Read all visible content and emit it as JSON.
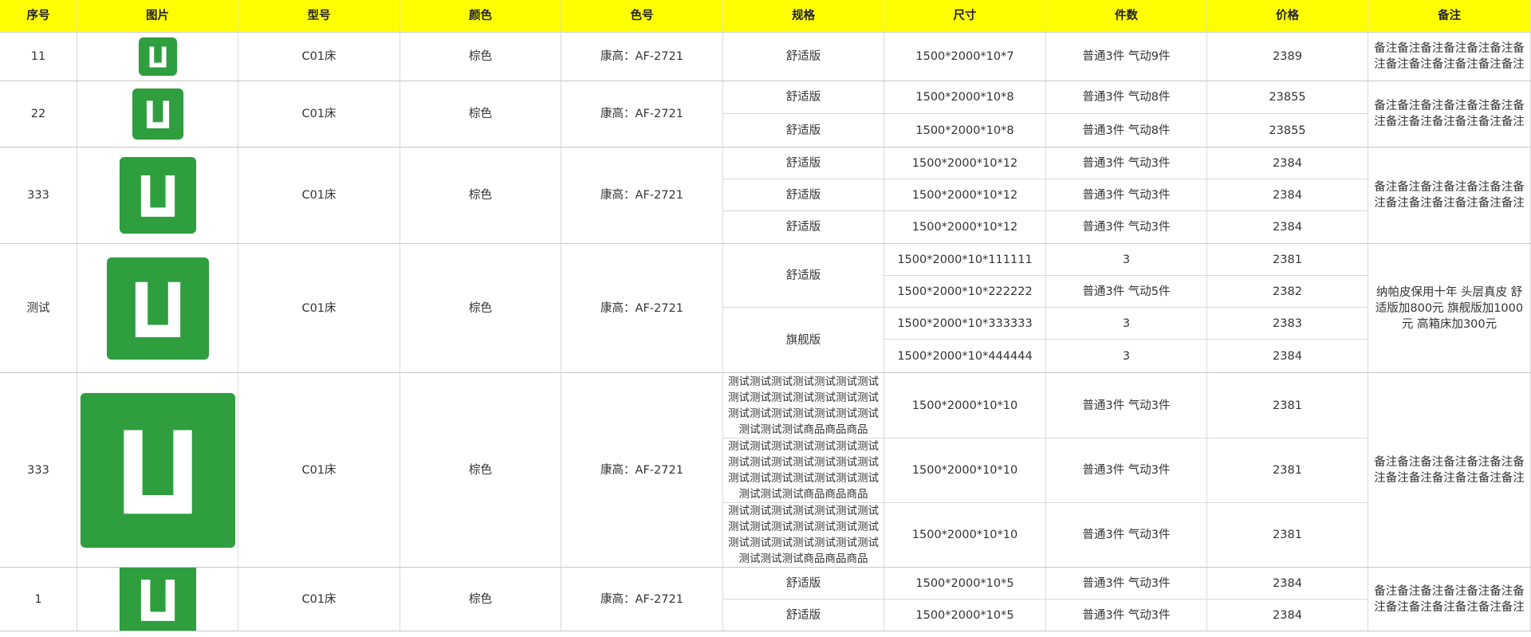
{
  "header": {
    "no": "序号",
    "image": "图片",
    "model": "型号",
    "color": "颜色",
    "color_code": "色号",
    "spec": "规格",
    "size": "尺寸",
    "pieces": "件数",
    "price": "价格",
    "remark": "备注"
  },
  "image_icon": "green-square-u-icon",
  "colors": {
    "header_bg": "#ffff00",
    "thumb_bg": "#2e9e3f"
  },
  "groups": [
    {
      "no": "11",
      "model": "C01床",
      "color": "棕色",
      "color_code": "康高：AF-2721",
      "remark": "备注备注备注备注备注备注备注备注备注备注备注备注备注",
      "specs": [
        {
          "label": "舒适版"
        }
      ],
      "rows": [
        {
          "size": "1500*2000*10*7",
          "pieces": "普通3件 气动9件",
          "price": "2389"
        }
      ]
    },
    {
      "no": "22",
      "model": "C01床",
      "color": "棕色",
      "color_code": "康高：AF-2721",
      "remark": "备注备注备注备注备注备注备注备注备注备注备注备注备注",
      "specs": [
        {
          "label": "舒适版"
        },
        {
          "label": "舒适版"
        }
      ],
      "rows": [
        {
          "size": "1500*2000*10*8",
          "pieces": "普通3件 气动8件",
          "price": "23855"
        },
        {
          "size": "1500*2000*10*8",
          "pieces": "普通3件 气动8件",
          "price": "23855"
        }
      ]
    },
    {
      "no": "333",
      "model": "C01床",
      "color": "棕色",
      "color_code": "康高：AF-2721",
      "remark": "备注备注备注备注备注备注备注备注备注备注备注备注备注",
      "specs": [
        {
          "label": "舒适版"
        },
        {
          "label": "舒适版"
        },
        {
          "label": "舒适版"
        }
      ],
      "rows": [
        {
          "size": "1500*2000*10*12",
          "pieces": "普通3件 气动3件",
          "price": "2384"
        },
        {
          "size": "1500*2000*10*12",
          "pieces": "普通3件 气动3件",
          "price": "2384"
        },
        {
          "size": "1500*2000*10*12",
          "pieces": "普通3件 气动3件",
          "price": "2384"
        }
      ]
    },
    {
      "no": "测试",
      "model": "C01床",
      "color": "棕色",
      "color_code": "康高：AF-2721",
      "remark": "纳帕皮保用十年 头层真皮 舒适版加800元 旗舰版加1000元 高箱床加300元",
      "specs": [
        {
          "label": "舒适版"
        },
        {
          "label": "旗舰版"
        }
      ],
      "rows": [
        {
          "size": "1500*2000*10*111111",
          "pieces": "3",
          "price": "2381"
        },
        {
          "size": "1500*2000*10*222222",
          "pieces": "普通3件 气动5件",
          "price": "2382"
        },
        {
          "size": "1500*2000*10*333333",
          "pieces": "3",
          "price": "2383"
        },
        {
          "size": "1500*2000*10*444444",
          "pieces": "3",
          "price": "2384"
        }
      ]
    },
    {
      "no": "333",
      "model": "C01床",
      "color": "棕色",
      "color_code": "康高：AF-2721",
      "remark": "备注备注备注备注备注备注备注备注备注备注备注备注备注",
      "specs": [
        {
          "label": "测试测试测试测试测试测试测试测试测试测试测试测试测试测试测试测试测试测试测试测试测试测试测试测试商品商品商品"
        },
        {
          "label": "测试测试测试测试测试测试测试测试测试测试测试测试测试测试测试测试测试测试测试测试测试测试测试测试商品商品商品"
        },
        {
          "label": "测试测试测试测试测试测试测试测试测试测试测试测试测试测试测试测试测试测试测试测试测试测试测试测试商品商品商品"
        }
      ],
      "rows": [
        {
          "size": "1500*2000*10*10",
          "pieces": "普通3件 气动3件",
          "price": "2381"
        },
        {
          "size": "1500*2000*10*10",
          "pieces": "普通3件 气动3件",
          "price": "2381"
        },
        {
          "size": "1500*2000*10*10",
          "pieces": "普通3件 气动3件",
          "price": "2381"
        }
      ]
    },
    {
      "no": "1",
      "model": "C01床",
      "color": "棕色",
      "color_code": "康高：AF-2721",
      "remark": "备注备注备注备注备注备注备注备注备注备注备注备注备注",
      "specs": [
        {
          "label": "舒适版"
        },
        {
          "label": "舒适版"
        }
      ],
      "rows": [
        {
          "size": "1500*2000*10*5",
          "pieces": "普通3件 气动3件",
          "price": "2384"
        },
        {
          "size": "1500*2000*10*5",
          "pieces": "普通3件 气动3件",
          "price": "2384"
        }
      ]
    }
  ]
}
